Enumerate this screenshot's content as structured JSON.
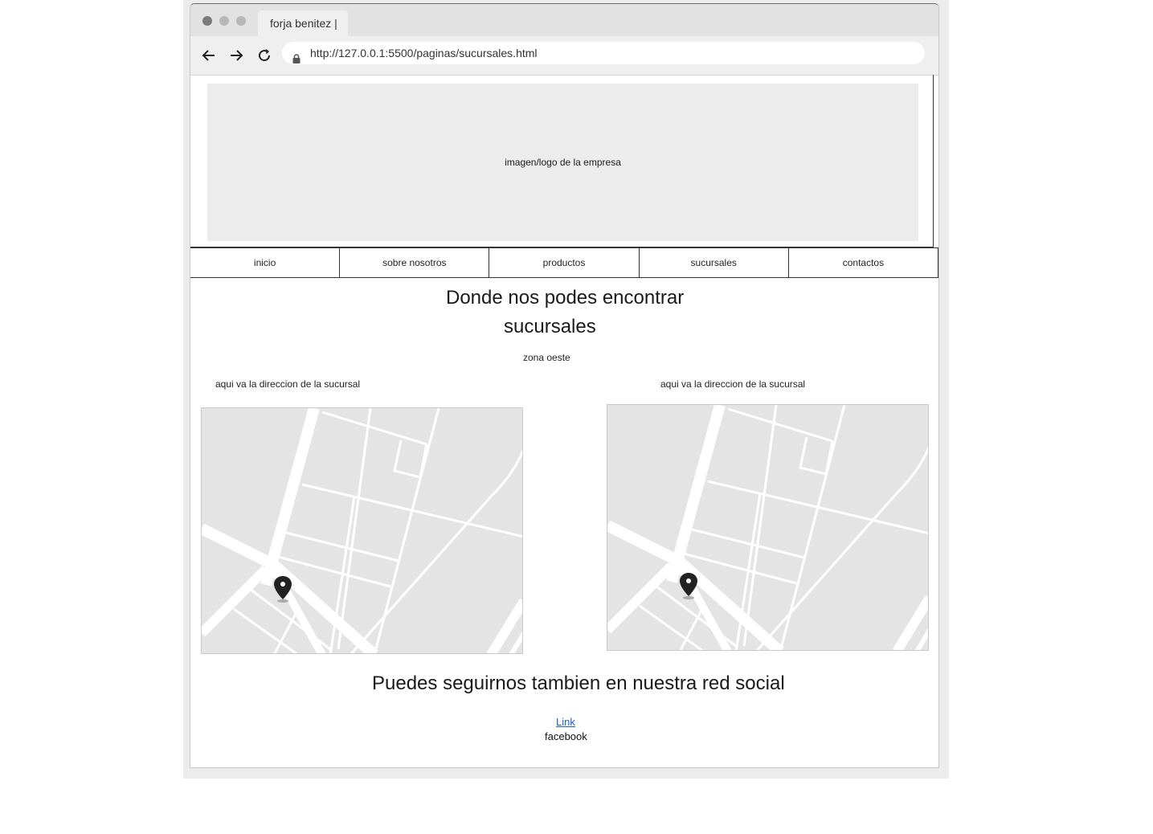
{
  "browser": {
    "tab_title": "forja benitez |",
    "url": "http://127.0.0.1:5500/paginas/sucursales.html"
  },
  "header": {
    "logo_placeholder": "imagen/logo de la empresa"
  },
  "nav": {
    "items": [
      "inicio",
      "sobre nosotros",
      "productos",
      "sucursales",
      "contactos"
    ]
  },
  "main": {
    "title_line1": "Donde nos podes encontrar",
    "title_line2": "sucursales",
    "zone": "zona oeste",
    "branches": [
      {
        "address": "aqui va la direccion de la sucursal"
      },
      {
        "address": "aqui va la direccion de la sucursal"
      }
    ]
  },
  "social": {
    "title": "Puedes seguirnos tambien en nuestra red social",
    "link_text": "Link",
    "network": "facebook"
  },
  "icons": [
    "back-arrow-icon",
    "forward-arrow-icon",
    "reload-icon",
    "lock-icon",
    "map-pin-icon"
  ]
}
